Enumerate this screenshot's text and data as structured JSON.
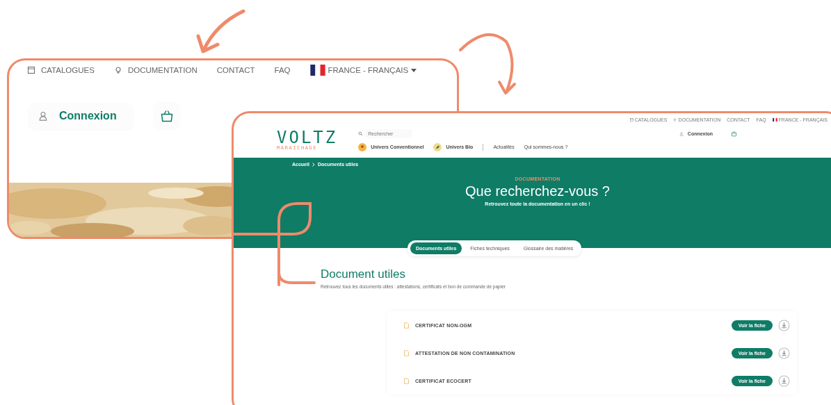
{
  "back_screen": {
    "nav": [
      "CATALOGUES",
      "DOCUMENTATION",
      "CONTACT",
      "FAQ"
    ],
    "language": "FRANCE - FRANÇAIS",
    "login": "Connexion"
  },
  "front_screen": {
    "top_links": [
      "CATALOGUES",
      "DOCUMENTATION",
      "CONTACT",
      "FAQ"
    ],
    "language": "FRANCE - FRANÇAIS",
    "logo": {
      "name": "VOLTZ",
      "tagline": "MARAICHAGE"
    },
    "search": {
      "placeholder": "Rechercher"
    },
    "login": "Connexion",
    "menu": [
      "Univers Conventionnel",
      "Univers Bio",
      "Actualités",
      "Qui sommes-nous ?"
    ],
    "breadcrumb": [
      "Accueil",
      "Documents utiles"
    ],
    "hero": {
      "eyebrow": "DOCUMENTATION",
      "title": "Que recherchez-vous ?",
      "subtitle": "Retrouvez toute la documentation en un clic !"
    },
    "tabs": [
      {
        "label": "Documents utiles",
        "selected": true
      },
      {
        "label": "Fiches techniques",
        "selected": false
      },
      {
        "label": "Glossaire des matières",
        "selected": false
      }
    ],
    "section": {
      "title": "Document utiles",
      "description": "Retrouvez tous les documents utiles : attestations, certificats et bon de commande de papier"
    },
    "documents": [
      {
        "name": "CERTIFICAT NON-OGM",
        "button": "Voir la fiche"
      },
      {
        "name": "ATTESTATION DE NON CONTAMINATION",
        "button": "Voir la fiche"
      },
      {
        "name": "CERTIFICAT ECOCERT",
        "button": "Voir la fiche"
      }
    ]
  }
}
